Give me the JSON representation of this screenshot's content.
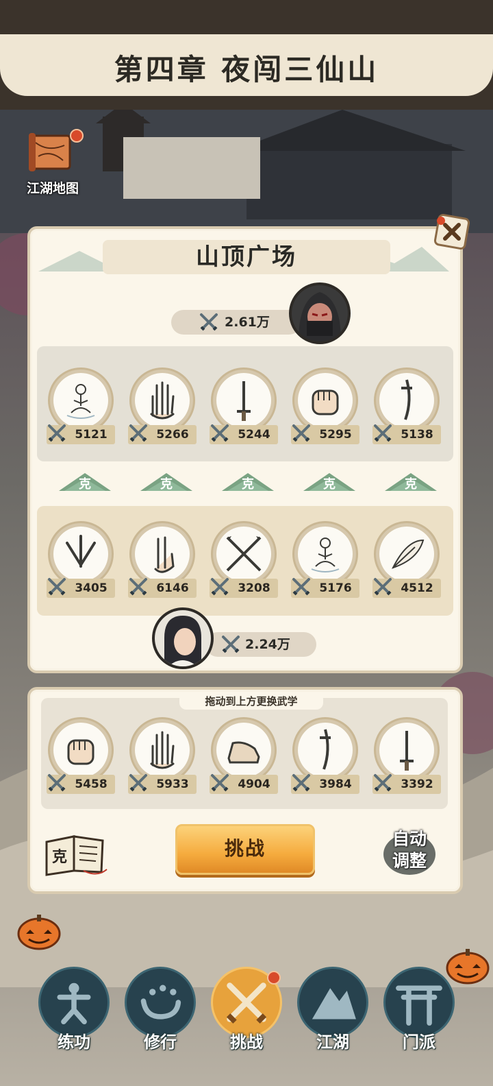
{
  "chapter": {
    "title": "第四章 夜闯三仙山"
  },
  "map_button": {
    "label": "江湖地图"
  },
  "stage": {
    "name": "山顶广场",
    "enemy_power": "2.61万",
    "player_power": "2.24万"
  },
  "enemy_skills": [
    {
      "icon": "meditating-monk-icon",
      "value": "5121"
    },
    {
      "icon": "open-palm-icon",
      "value": "5266"
    },
    {
      "icon": "straight-sword-icon",
      "value": "5244"
    },
    {
      "icon": "fist-icon",
      "value": "5295"
    },
    {
      "icon": "saber-icon",
      "value": "5138"
    }
  ],
  "counter_label": "克",
  "player_skills": [
    {
      "icon": "throwing-knives-icon",
      "value": "3405"
    },
    {
      "icon": "two-finger-icon",
      "value": "6146"
    },
    {
      "icon": "crossed-spears-icon",
      "value": "3208"
    },
    {
      "icon": "meditating-monk-icon",
      "value": "5176"
    },
    {
      "icon": "feather-icon",
      "value": "4512"
    }
  ],
  "bench": {
    "hint": "拖动到上方更换武学",
    "skills": [
      {
        "icon": "fist-icon",
        "value": "5458"
      },
      {
        "icon": "open-palm-icon",
        "value": "5933"
      },
      {
        "icon": "boot-icon",
        "value": "4904"
      },
      {
        "icon": "saber-icon",
        "value": "3984"
      },
      {
        "icon": "straight-sword-icon",
        "value": "3392"
      }
    ]
  },
  "actions": {
    "book_icon_text": "克",
    "challenge": "挑战",
    "auto_adjust_line1": "自动",
    "auto_adjust_line2": "调整"
  },
  "nav": [
    {
      "icon": "kung-fu-icon",
      "label": "练功"
    },
    {
      "icon": "heart-mind-icon",
      "label": "修行"
    },
    {
      "icon": "crossed-swords-icon",
      "label": "挑战",
      "active": true
    },
    {
      "icon": "mountain-icon",
      "label": "江湖"
    },
    {
      "icon": "torii-gate-icon",
      "label": "门派"
    }
  ],
  "colors": {
    "challenge_button": "#f5ab3e",
    "panel_bg": "#fbf6ea",
    "counter_green": "#7aa383",
    "nav_circle": "#27424e"
  }
}
